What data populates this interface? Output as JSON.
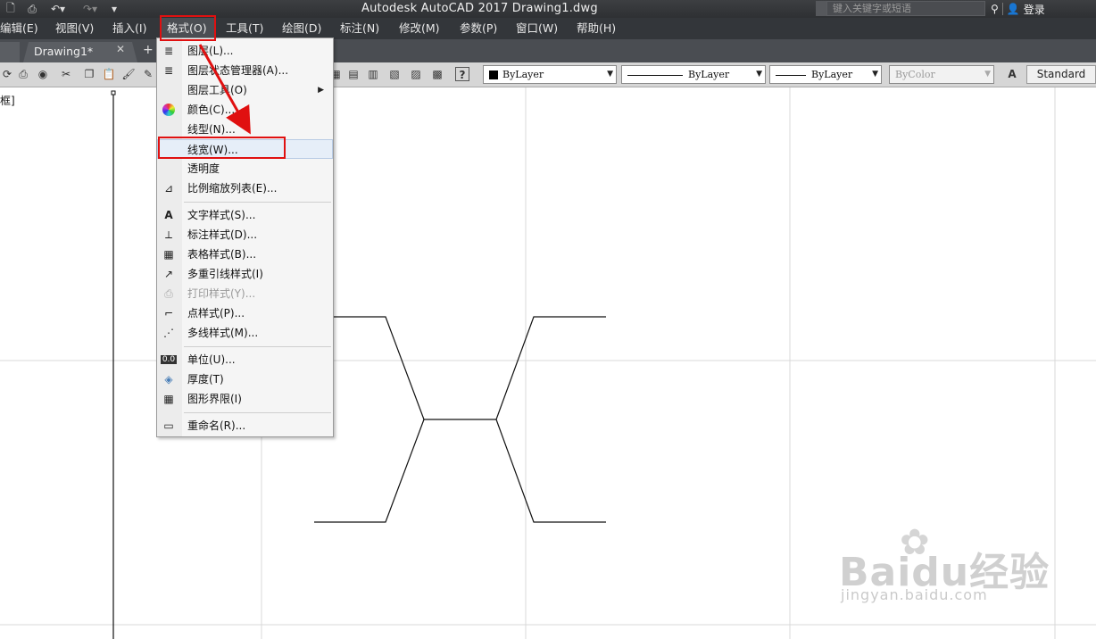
{
  "titlebar": {
    "app_title": "Autodesk AutoCAD 2017    Drawing1.dwg",
    "search_placeholder": "键入关键字或短语",
    "login_label": "登录",
    "quick_access": [
      "new-icon",
      "print-icon",
      "undo-icon",
      "redo-icon",
      "customize-icon"
    ]
  },
  "menubar": {
    "items": [
      {
        "label": "编辑(E)"
      },
      {
        "label": "视图(V)"
      },
      {
        "label": "插入(I)"
      },
      {
        "label": "格式(O)"
      },
      {
        "label": "工具(T)"
      },
      {
        "label": "绘图(D)"
      },
      {
        "label": "标注(N)"
      },
      {
        "label": "修改(M)"
      },
      {
        "label": "参数(P)"
      },
      {
        "label": "窗口(W)"
      },
      {
        "label": "帮助(H)"
      }
    ]
  },
  "tabs": {
    "active_tab": "Drawing1*",
    "close_glyph": "✕",
    "add_glyph": "+"
  },
  "toolbar": {
    "color_dropdown": "ByLayer",
    "linetype_dropdown": "ByLayer",
    "lineweight_dropdown": "ByLayer",
    "plotstyle_dropdown": "ByColor",
    "text_style": "Standard"
  },
  "canvas": {
    "viewport_label": "框]"
  },
  "format_menu": {
    "items": [
      {
        "label": "图层(L)...",
        "icon": "layer-icon"
      },
      {
        "label": "图层状态管理器(A)...",
        "icon": "layer-state-icon"
      },
      {
        "label": "图层工具(O)",
        "icon": "none",
        "submenu": true
      },
      {
        "label": "颜色(C)...",
        "icon": "color-wheel-icon"
      },
      {
        "label": "线型(N)...",
        "icon": "none"
      },
      {
        "label": "线宽(W)...",
        "icon": "none",
        "highlighted": true
      },
      {
        "label": "透明度",
        "icon": "none"
      },
      {
        "label": "比例缩放列表(E)...",
        "icon": "scale-list-icon"
      },
      {
        "label": "文字样式(S)...",
        "icon": "text-style-icon"
      },
      {
        "label": "标注样式(D)...",
        "icon": "dim-style-icon"
      },
      {
        "label": "表格样式(B)...",
        "icon": "table-style-icon"
      },
      {
        "label": "多重引线样式(I)",
        "icon": "mleader-style-icon"
      },
      {
        "label": "打印样式(Y)...",
        "icon": "plot-style-icon",
        "disabled": true
      },
      {
        "label": "点样式(P)...",
        "icon": "point-style-icon"
      },
      {
        "label": "多线样式(M)...",
        "icon": "mline-style-icon"
      },
      {
        "label": "单位(U)...",
        "icon": "units-icon"
      },
      {
        "label": "厚度(T)",
        "icon": "thickness-icon"
      },
      {
        "label": "图形界限(I)",
        "icon": "limits-icon"
      },
      {
        "label": "重命名(R)...",
        "icon": "rename-icon"
      }
    ]
  },
  "watermark": {
    "brand": "Baidu经验",
    "url": "jingyan.baidu.com"
  },
  "colors": {
    "highlight_red": "#e01010",
    "menubar_bg": "#33363a",
    "toolbar_bg": "#d6d6d6"
  }
}
